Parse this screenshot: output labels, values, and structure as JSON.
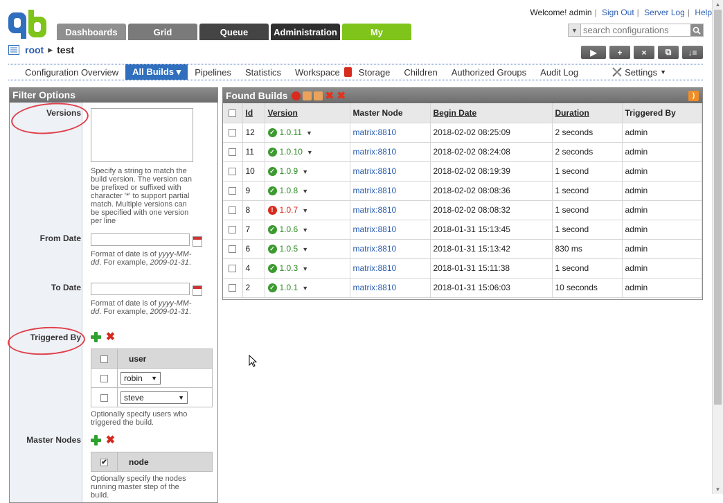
{
  "header": {
    "welcome": "Welcome! admin",
    "links": [
      "Sign Out",
      "Server Log",
      "Help"
    ],
    "tabs": [
      {
        "label": "Dashboards",
        "color": "#8f8f8f"
      },
      {
        "label": "Grid",
        "color": "#7a7a7a"
      },
      {
        "label": "Queue",
        "color": "#444444"
      },
      {
        "label": "Administration",
        "color": "#2f2f2f"
      },
      {
        "label": "My",
        "color": "#7fc41b"
      }
    ],
    "search_placeholder": "search configurations",
    "accent": "#2f6fbd"
  },
  "breadcrumb": {
    "root": "root",
    "current": "test"
  },
  "toolbar": {
    "run": "▶",
    "add": "+",
    "delete": "×",
    "copy": "⧉",
    "sort": "↓≡"
  },
  "nav": {
    "items": [
      {
        "label": "Configuration Overview"
      },
      {
        "label": "All Builds ▾",
        "active": true
      },
      {
        "label": "Pipelines"
      },
      {
        "label": "Statistics"
      },
      {
        "label": "Workspace"
      },
      {
        "label": "Storage"
      },
      {
        "label": "Children"
      },
      {
        "label": "Authorized Groups"
      },
      {
        "label": "Audit Log"
      }
    ],
    "settings": "Settings"
  },
  "filter": {
    "title": "Filter Options",
    "versions_label": "Versions",
    "versions_hint": "Specify a string to match the build version. The version can be prefixed or suffixed with character '*' to support partial match. Multiple versions can be specified with one version per line",
    "from_label": "From Date",
    "from_hint_pre": "Format of date is of ",
    "from_hint_fmt": "yyyy-MM-dd",
    "from_hint_mid": ". For example, ",
    "from_hint_ex": "2009-01-31",
    "to_label": "To Date",
    "trig_label": "Triggered By",
    "user_header": "user",
    "users": [
      "robin",
      "steve"
    ],
    "trig_hint": "Optionally specify users who triggered the build.",
    "nodes_label": "Master Nodes",
    "node_header": "node",
    "nodes_hint": "Optionally specify the nodes running master step of the build."
  },
  "results": {
    "title": "Found Builds",
    "columns": [
      "Id",
      "Version",
      "Master Node",
      "Begin Date",
      "Duration",
      "Triggered By"
    ],
    "rows": [
      {
        "id": "12",
        "version": "1.0.11",
        "status": "ok",
        "node": "matrix:8810",
        "begin": "2018-02-02 08:25:09",
        "duration": "2 seconds",
        "by": "admin"
      },
      {
        "id": "11",
        "version": "1.0.10",
        "status": "ok",
        "node": "matrix:8810",
        "begin": "2018-02-02 08:24:08",
        "duration": "2 seconds",
        "by": "admin"
      },
      {
        "id": "10",
        "version": "1.0.9",
        "status": "ok",
        "node": "matrix:8810",
        "begin": "2018-02-02 08:19:39",
        "duration": "1 second",
        "by": "admin"
      },
      {
        "id": "9",
        "version": "1.0.8",
        "status": "ok",
        "node": "matrix:8810",
        "begin": "2018-02-02 08:08:36",
        "duration": "1 second",
        "by": "admin"
      },
      {
        "id": "8",
        "version": "1.0.7",
        "status": "err",
        "node": "matrix:8810",
        "begin": "2018-02-02 08:08:32",
        "duration": "1 second",
        "by": "admin"
      },
      {
        "id": "7",
        "version": "1.0.6",
        "status": "ok",
        "node": "matrix:8810",
        "begin": "2018-01-31 15:13:45",
        "duration": "1 second",
        "by": "admin"
      },
      {
        "id": "6",
        "version": "1.0.5",
        "status": "ok",
        "node": "matrix:8810",
        "begin": "2018-01-31 15:13:42",
        "duration": "830 ms",
        "by": "admin"
      },
      {
        "id": "4",
        "version": "1.0.3",
        "status": "ok",
        "node": "matrix:8810",
        "begin": "2018-01-31 15:11:38",
        "duration": "1 second",
        "by": "admin"
      },
      {
        "id": "2",
        "version": "1.0.1",
        "status": "ok",
        "node": "matrix:8810",
        "begin": "2018-01-31 15:06:03",
        "duration": "10 seconds",
        "by": "admin"
      }
    ]
  }
}
